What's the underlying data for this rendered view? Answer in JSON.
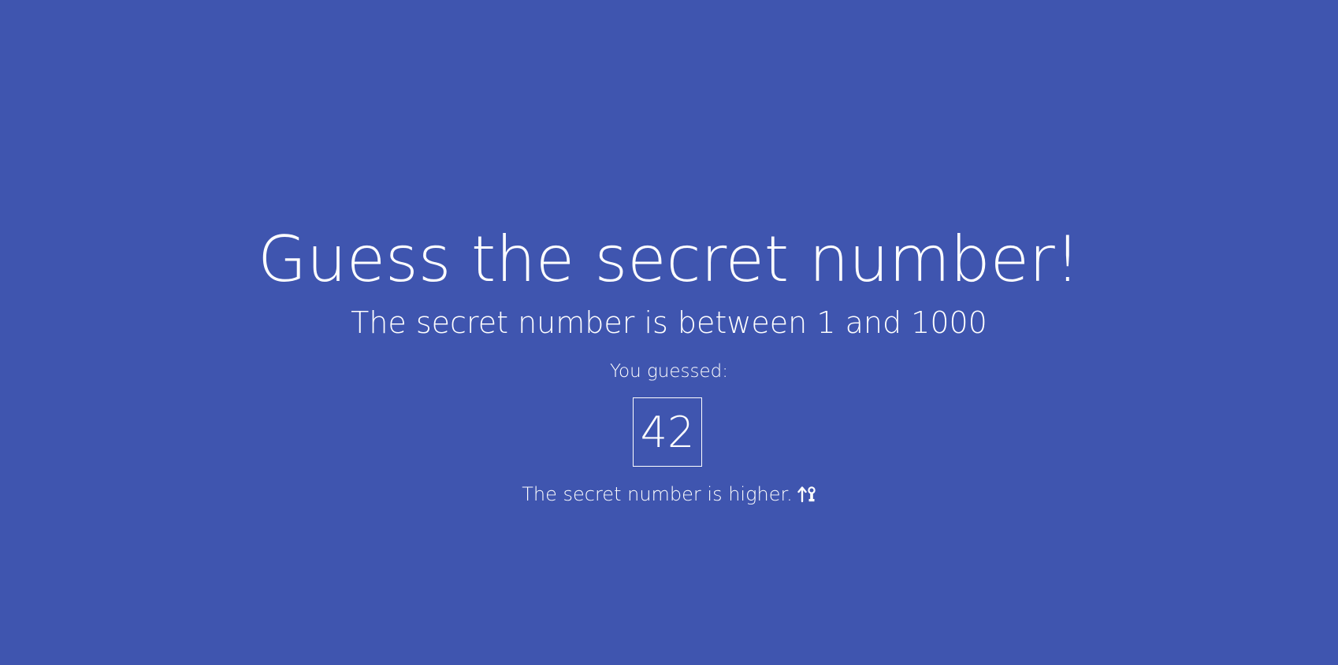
{
  "game": {
    "title": "Guess the secret number!",
    "subtitle": "The secret number is between 1 and 1000",
    "guess_label": "You guessed:",
    "guess_value": "42",
    "hint_text": "The secret number is higher.",
    "hint_icon": "arrow-up-keyhole-icon"
  },
  "colors": {
    "background": "#3f55af",
    "text": "#ffffff"
  }
}
